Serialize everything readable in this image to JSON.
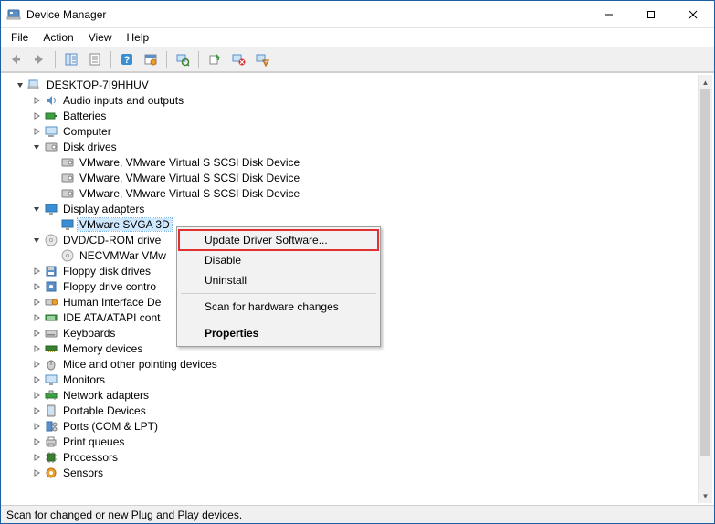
{
  "window": {
    "title": "Device Manager"
  },
  "menu": {
    "file": "File",
    "action": "Action",
    "view": "View",
    "help": "Help"
  },
  "toolbar": {
    "back": "back",
    "forward": "forward",
    "show_hide": "show-hide-console-tree",
    "properties": "properties",
    "help": "help",
    "show_hidden": "show-hidden-devices",
    "scan": "scan-for-hardware-changes",
    "update": "update-driver",
    "uninstall": "uninstall",
    "disable": "disable"
  },
  "tree": {
    "root": "DESKTOP-7I9HHUV",
    "items": [
      {
        "label": "Audio inputs and outputs",
        "expander": "closed",
        "icon": "audio"
      },
      {
        "label": "Batteries",
        "expander": "closed",
        "icon": "battery"
      },
      {
        "label": "Computer",
        "expander": "closed",
        "icon": "computer"
      },
      {
        "label": "Disk drives",
        "expander": "open",
        "icon": "disk",
        "children": [
          {
            "label": "VMware, VMware Virtual S SCSI Disk Device",
            "icon": "disk"
          },
          {
            "label": "VMware, VMware Virtual S SCSI Disk Device",
            "icon": "disk"
          },
          {
            "label": "VMware, VMware Virtual S SCSI Disk Device",
            "icon": "disk"
          }
        ]
      },
      {
        "label": "Display adapters",
        "expander": "open",
        "icon": "display",
        "children": [
          {
            "label": "VMware SVGA 3D",
            "icon": "display",
            "selected": true
          }
        ]
      },
      {
        "label": "DVD/CD-ROM drive",
        "expander": "open",
        "icon": "dvd",
        "children": [
          {
            "label": "NECVMWar VMw",
            "icon": "dvd"
          }
        ]
      },
      {
        "label": "Floppy disk drives",
        "expander": "closed",
        "icon": "floppy"
      },
      {
        "label": "Floppy drive contro",
        "expander": "closed",
        "icon": "floppy-ctrl"
      },
      {
        "label": "Human Interface De",
        "expander": "closed",
        "icon": "hid"
      },
      {
        "label": "IDE ATA/ATAPI cont",
        "expander": "closed",
        "icon": "ide"
      },
      {
        "label": "Keyboards",
        "expander": "closed",
        "icon": "keyboard"
      },
      {
        "label": "Memory devices",
        "expander": "closed",
        "icon": "memory"
      },
      {
        "label": "Mice and other pointing devices",
        "expander": "closed",
        "icon": "mouse"
      },
      {
        "label": "Monitors",
        "expander": "closed",
        "icon": "monitor"
      },
      {
        "label": "Network adapters",
        "expander": "closed",
        "icon": "network"
      },
      {
        "label": "Portable Devices",
        "expander": "closed",
        "icon": "portable"
      },
      {
        "label": "Ports (COM & LPT)",
        "expander": "closed",
        "icon": "ports"
      },
      {
        "label": "Print queues",
        "expander": "closed",
        "icon": "printer"
      },
      {
        "label": "Processors",
        "expander": "closed",
        "icon": "cpu"
      },
      {
        "label": "Sensors",
        "expander": "closed",
        "icon": "sensor"
      }
    ]
  },
  "context_menu": {
    "update_driver": "Update Driver Software...",
    "disable": "Disable",
    "uninstall": "Uninstall",
    "scan": "Scan for hardware changes",
    "properties": "Properties"
  },
  "status": {
    "text": "Scan for changed or new Plug and Play devices."
  }
}
